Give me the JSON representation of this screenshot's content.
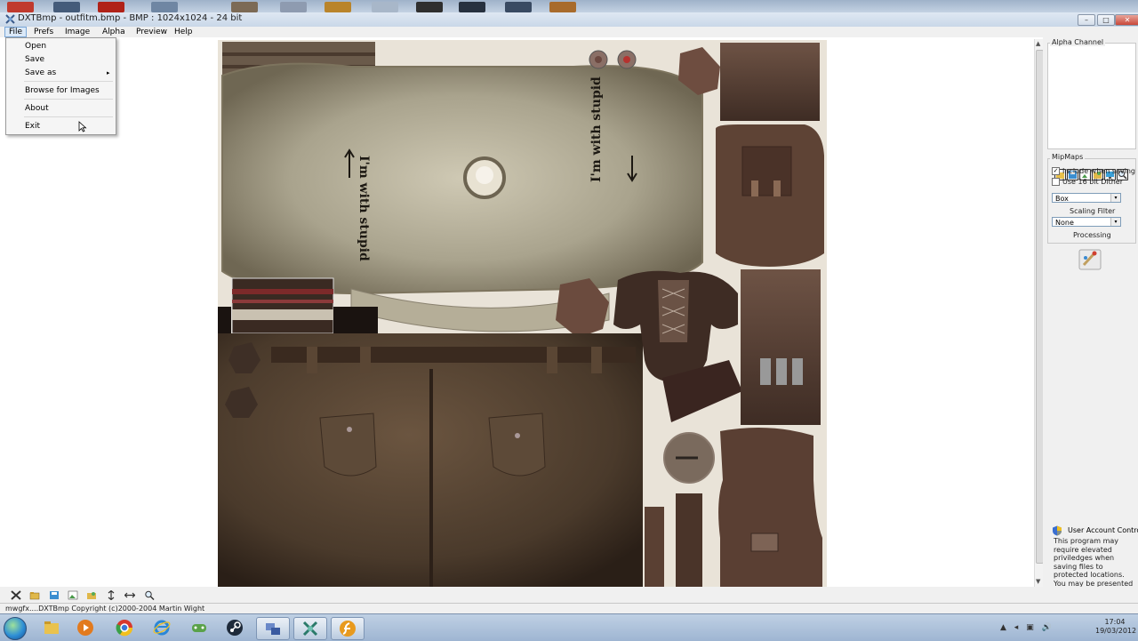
{
  "window": {
    "title": "DXTBmp - outfitm.bmp - BMP : 1024x1024 - 24 bit",
    "minimize_glyph": "–",
    "maximize_glyph": "□",
    "close_glyph": "✕"
  },
  "menubar": {
    "items": [
      {
        "label": "File"
      },
      {
        "label": "Prefs"
      },
      {
        "label": "Image"
      },
      {
        "label": "Alpha"
      },
      {
        "label": "Preview"
      },
      {
        "label": "Help"
      }
    ]
  },
  "file_menu": {
    "items": [
      {
        "label": "Open"
      },
      {
        "label": "Save"
      },
      {
        "label": "Save as",
        "submenu_glyph": "▸"
      },
      {
        "label": "Browse for Images"
      },
      {
        "label": "About"
      },
      {
        "label": "Exit"
      }
    ]
  },
  "texture": {
    "left_arrow_text": "I'm with stupid",
    "right_arrow_text": "I'm with stupid"
  },
  "right_panel": {
    "alpha_channel_title": "Alpha Channel",
    "mipmaps_title": "MipMaps",
    "include_when_saving": {
      "label": "Include when saving",
      "checked": true,
      "check_glyph": "✓"
    },
    "use_16bit_dither": {
      "label": "Use 16 bit Dither",
      "checked": false
    },
    "scaling_filter": {
      "value": "Box",
      "label": "Scaling Filter"
    },
    "processing": {
      "value": "None",
      "label": "Processing"
    },
    "dropdown_glyph": "▾",
    "uac_title": "User Account Control",
    "uac_body": "This program may require elevated priviledges when saving files to protected locations. You may be presented with the UAC prompt when saving files"
  },
  "scrollbar": {
    "up_glyph": "▲",
    "down_glyph": "▼"
  },
  "statusbar": {
    "text": "mwgfx....DXTBmp Copyright (c)2000-2004 Martin Wight"
  },
  "taskbar": {
    "clock_time": "17:04",
    "clock_date": "19/03/2012",
    "tray_glyphs": [
      "▲",
      "◂",
      "▣",
      "🔊"
    ]
  },
  "colors": {
    "title_bar": "#c9d7e8",
    "menu_highlight": "#dbe9f8",
    "taskbar": "#9eb5d2",
    "texture_shirt": "#a9a38d",
    "texture_pants": "#4a3a2b",
    "texture_leather": "#5d463a"
  }
}
